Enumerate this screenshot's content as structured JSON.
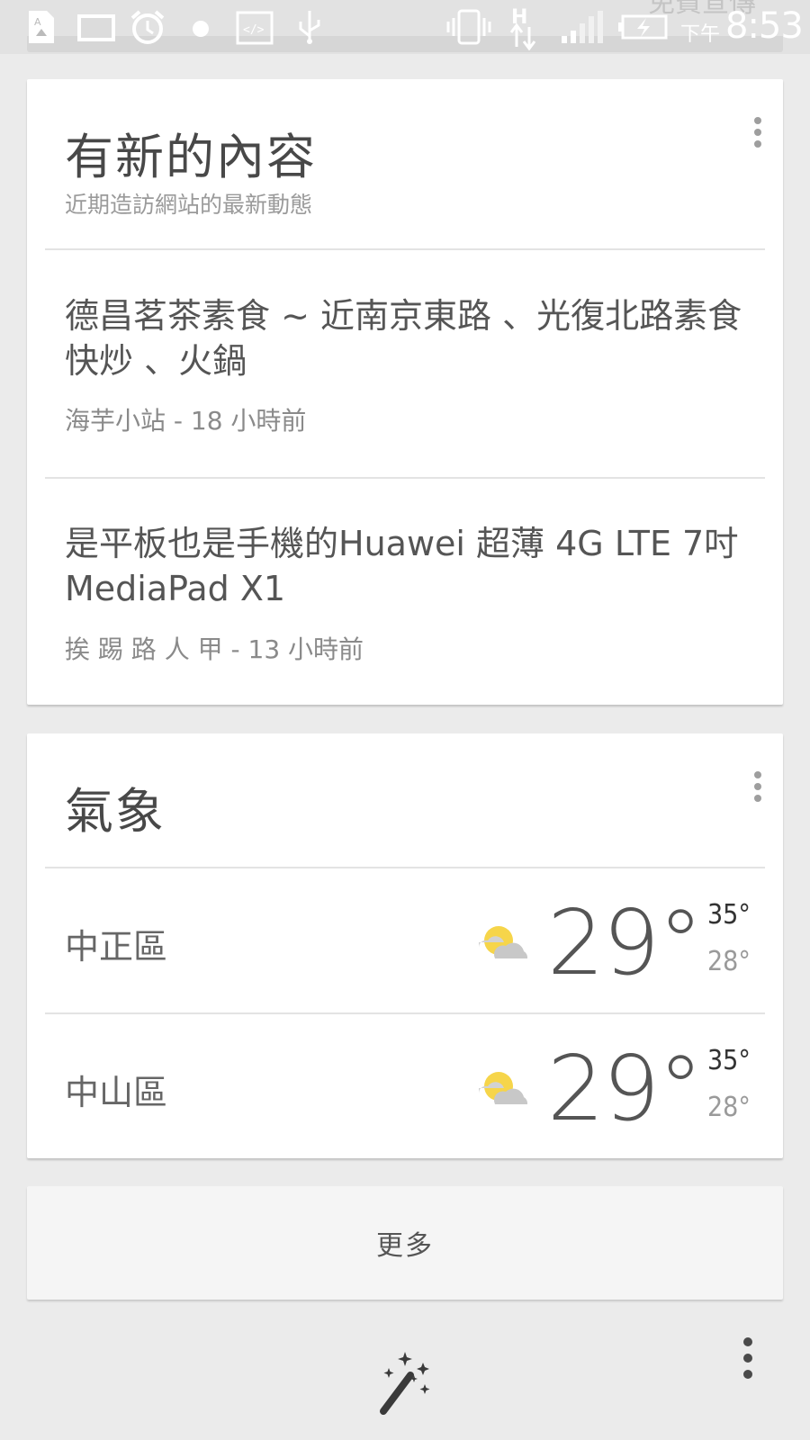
{
  "status_bar": {
    "title": "免費宣傳",
    "ampm": "下午",
    "time": "8:53",
    "icons": [
      "sim-card-icon",
      "image-icon",
      "alarm-icon",
      "dot-icon",
      "code-icon",
      "usb-icon",
      "vibrate-icon",
      "h-data-icon",
      "signal-icon",
      "battery-charging-icon"
    ]
  },
  "updates_card": {
    "title": "有新的內容",
    "subtitle": "近期造訪網站的最新動態",
    "menu_icon": "more-vert-icon",
    "articles": [
      {
        "title": "德昌茗茶素食 ~ 近南京東路 、光復北路素食快炒 、火鍋",
        "meta": "海芋小站 - 18 小時前"
      },
      {
        "title": "是平板也是手機的Huawei 超薄 4G LTE 7吋 MediaPad X1",
        "meta": "挨 踢 路 人 甲 - 13 小時前"
      }
    ]
  },
  "weather_card": {
    "title": "氣象",
    "menu_icon": "more-vert-icon",
    "rows": [
      {
        "city": "中正區",
        "icon": "partly-cloudy-icon",
        "temp": "29°",
        "high": "35°",
        "low": "28°"
      },
      {
        "city": "中山區",
        "icon": "partly-cloudy-icon",
        "temp": "29°",
        "high": "35°",
        "low": "28°"
      }
    ]
  },
  "more_button": {
    "label": "更多"
  },
  "bottom_bar": {
    "customize_icon": "magic-wand-icon",
    "menu_icon": "more-vert-icon"
  },
  "colors": {
    "background": "#ebebeb",
    "card": "#ffffff",
    "sun": "#f6d54a",
    "cloud": "#c8c8c8"
  }
}
